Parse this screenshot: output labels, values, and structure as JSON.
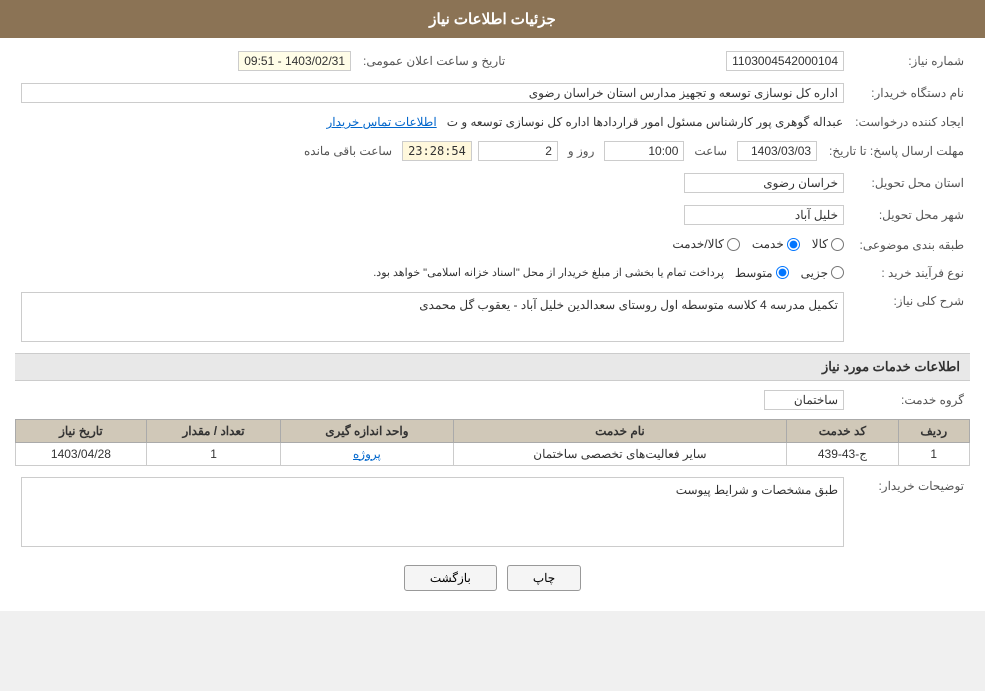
{
  "header": {
    "title": "جزئیات اطلاعات نیاز"
  },
  "fields": {
    "need_number_label": "شماره نیاز:",
    "need_number_value": "1103004542000104",
    "announcement_label": "تاریخ و ساعت اعلان عمومی:",
    "announcement_value": "1403/02/31 - 09:51",
    "buyer_org_label": "نام دستگاه خریدار:",
    "buyer_org_value": "اداره کل نوسازی  توسعه و تجهیز مدارس استان خراسان رضوی",
    "creator_label": "ایجاد کننده درخواست:",
    "creator_value": "عبداله گوهری پور کارشناس مسئول امور قراردادها  اداره کل نوسازی  توسعه و ت",
    "creator_link": "اطلاعات تماس خریدار",
    "deadline_label": "مهلت ارسال پاسخ: تا تاریخ:",
    "deadline_date": "1403/03/03",
    "deadline_time_label": "ساعت",
    "deadline_time": "10:00",
    "deadline_days_label": "روز و",
    "deadline_days": "2",
    "deadline_remaining_label": "ساعت باقی مانده",
    "deadline_remaining": "23:28:54",
    "province_label": "استان محل تحویل:",
    "province_value": "خراسان رضوی",
    "city_label": "شهر محل تحویل:",
    "city_value": "خلیل آباد",
    "classification_label": "طبقه بندی موضوعی:",
    "classification_options": [
      {
        "id": "kala",
        "label": "کالا"
      },
      {
        "id": "khedmat",
        "label": "خدمت"
      },
      {
        "id": "kala_khedmat",
        "label": "کالا/خدمت"
      }
    ],
    "classification_selected": "khedmat",
    "purchase_type_label": "نوع فرآیند خرید :",
    "purchase_type_options": [
      {
        "id": "jozvi",
        "label": "جزیی"
      },
      {
        "id": "motavasset",
        "label": "متوسط"
      }
    ],
    "purchase_type_note": "پرداخت تمام یا بخشی از مبلغ خریدار از محل \"اسناد خزانه اسلامی\" خواهد بود.",
    "description_label": "شرح کلی نیاز:",
    "description_value": "تکمیل مدرسه 4 کلاسه متوسطه اول روستای سعدالدین خلیل آباد - یعقوب گل محمدی",
    "services_section_title": "اطلاعات خدمات مورد نیاز",
    "service_group_label": "گروه خدمت:",
    "service_group_value": "ساختمان",
    "buyer_notes_label": "توضیحات خریدار:",
    "buyer_notes_value": "طبق مشخصات و شرایط پیوست"
  },
  "table": {
    "headers": [
      "ردیف",
      "کد خدمت",
      "نام خدمت",
      "واحد اندازه گیری",
      "تعداد / مقدار",
      "تاریخ نیاز"
    ],
    "rows": [
      {
        "row": "1",
        "code": "ج-43-439",
        "name": "سایر فعالیت‌های تخصصی ساختمان",
        "unit": "پروژه",
        "quantity": "1",
        "date": "1403/04/28"
      }
    ]
  },
  "buttons": {
    "print": "چاپ",
    "back": "بازگشت"
  }
}
